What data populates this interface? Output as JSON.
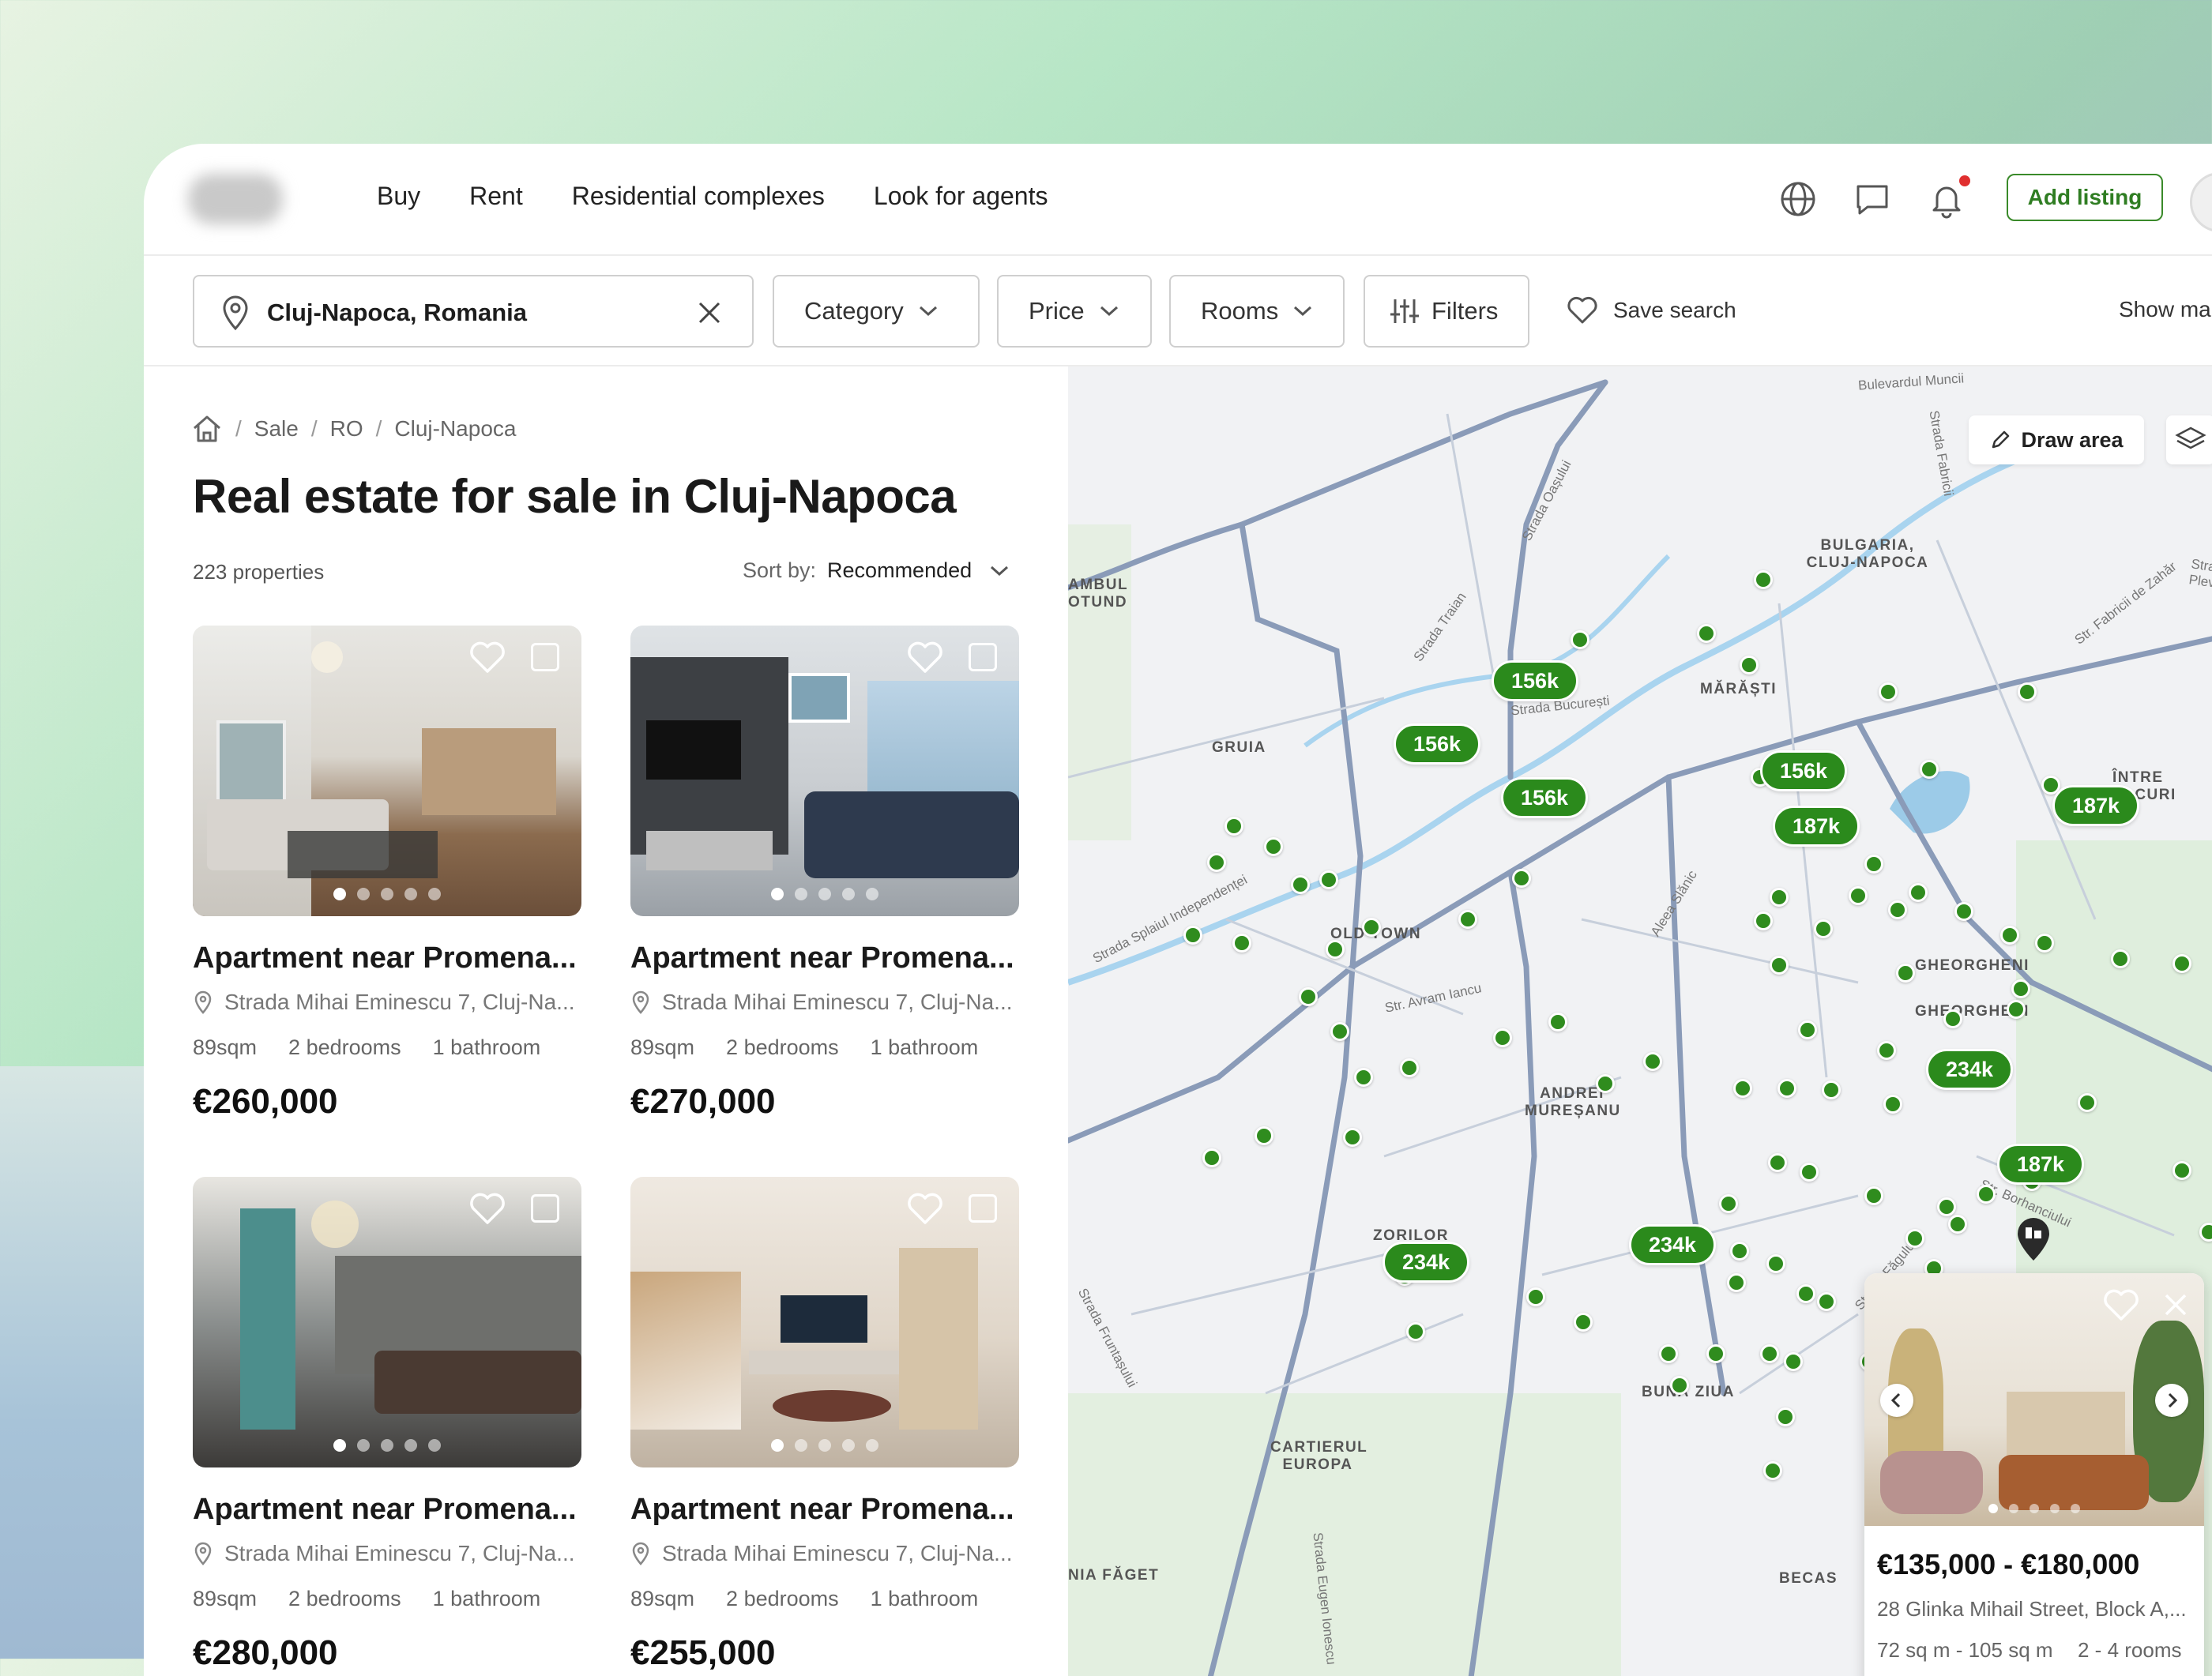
{
  "nav": {
    "items": [
      "Buy",
      "Rent",
      "Residential complexes",
      "Look for agents"
    ]
  },
  "header": {
    "add_listing": "Add listing"
  },
  "search": {
    "location": "Cluj-Napoca, Romania",
    "category": "Category",
    "price": "Price",
    "rooms": "Rooms",
    "filters": "Filters",
    "save_search": "Save search",
    "show_map": "Show ma"
  },
  "breadcrumb": [
    "Sale",
    "RO",
    "Cluj-Napoca"
  ],
  "page": {
    "title": "Real estate for sale in Cluj-Napoca",
    "count": "223 properties",
    "sort_label": "Sort by:",
    "sort_value": "Recommended"
  },
  "listings": [
    {
      "title": "Apartment near Promena...",
      "address": "Strada Mihai Eminescu 7, Cluj-Na...",
      "area": "89sqm",
      "bedrooms": "2 bedrooms",
      "bathrooms": "1 bathroom",
      "price": "€260,000"
    },
    {
      "title": "Apartment near Promena...",
      "address": "Strada Mihai Eminescu 7, Cluj-Na...",
      "area": "89sqm",
      "bedrooms": "2 bedrooms",
      "bathrooms": "1 bathroom",
      "price": "€270,000"
    },
    {
      "title": "Apartment near Promena...",
      "address": "Strada Mihai Eminescu 7, Cluj-Na...",
      "area": "89sqm",
      "bedrooms": "2 bedrooms",
      "bathrooms": "1 bathroom",
      "price": "€280,000"
    },
    {
      "title": "Apartment near Promena...",
      "address": "Strada Mihai Eminescu 7, Cluj-Na...",
      "area": "89sqm",
      "bedrooms": "2 bedrooms",
      "bathrooms": "1 bathroom",
      "price": "€255,000"
    }
  ],
  "map": {
    "draw_area": "Draw area",
    "price_pins": [
      "156k",
      "156k",
      "156k",
      "156k",
      "187k",
      "187k",
      "187k",
      "187k",
      "187k",
      "234k",
      "234k",
      "234k"
    ],
    "districts": [
      "GRUIA",
      "OLD TOWN",
      "MĂRĂȘTI",
      "BULGARIA, CLUJ-NAPOCA",
      "ÎNTRE LACURI",
      "GHEORGHENI",
      "ANDREI MUREȘANU",
      "ZORILOR",
      "BUNĂ ZIUA",
      "CARTIERUL EUROPA",
      "NIA FĂGET",
      "BECAS",
      "AMBUL",
      "OTUND"
    ],
    "streets": [
      "Bulevardul Muncii",
      "Strada Oașului",
      "Strada Fabricii",
      "Strada Plevnei",
      "Strada Traian",
      "Strada București",
      "Strada Splaiul Independenței",
      "Str. Avram Iancu",
      "Aleea Slănic",
      "Str. Borhanciului",
      "Strada Făgului",
      "Strada Fruntașului",
      "Strada Eugen Ionescu",
      "Str. Fabricii de Zahăr"
    ],
    "popup": {
      "price": "€135,000 - €180,000",
      "address": "28 Glinka Mihail Street, Block A,...",
      "size": "72 sq m - 105 sq m",
      "rooms": "2 - 4 rooms"
    }
  },
  "colors": {
    "accent": "#2b8a1c",
    "notification": "#e02f2f"
  }
}
